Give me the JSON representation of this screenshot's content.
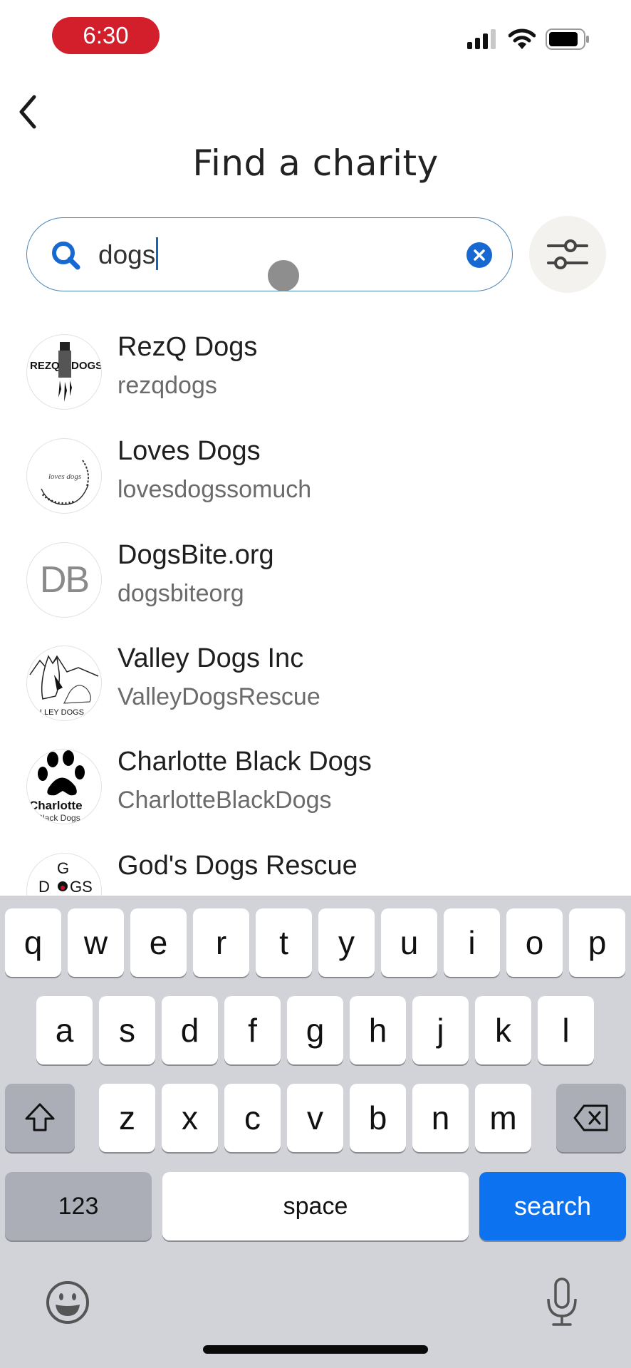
{
  "status_bar": {
    "time": "6:30",
    "time_pill_color": "#d21f2b",
    "icons": [
      "cellular-signal-icon",
      "wifi-icon",
      "battery-icon"
    ]
  },
  "header": {
    "back_icon": "chevron-left-icon",
    "title": "Find a charity"
  },
  "search": {
    "icon": "search-icon",
    "value": "dogs",
    "clear_icon": "clear-icon",
    "filter_icon": "sliders-icon",
    "accent_color": "#1769d1"
  },
  "results": [
    {
      "name": "RezQ Dogs",
      "handle": "rezqdogs",
      "avatar": "rezq-dogs-logo"
    },
    {
      "name": "Loves Dogs",
      "handle": "lovesdogssomuch",
      "avatar": "loves-dogs-logo"
    },
    {
      "name": "DogsBite.org",
      "handle": "dogsbiteorg",
      "avatar_initials": "DB"
    },
    {
      "name": "Valley Dogs Inc",
      "handle": "ValleyDogsRescue",
      "avatar": "valley-dogs-logo",
      "avatar_text": "VALLEY DOGS"
    },
    {
      "name": "Charlotte Black Dogs",
      "handle": "CharlotteBlackDogs",
      "avatar": "charlotte-paw-logo",
      "avatar_text": "Charlotte",
      "avatar_subtext": "Black Dogs"
    },
    {
      "name": "God's Dogs Rescue",
      "handle": "",
      "avatar": "gods-dogs-logo",
      "avatar_text": "DOGS"
    }
  ],
  "keyboard": {
    "row1": [
      "q",
      "w",
      "e",
      "r",
      "t",
      "y",
      "u",
      "i",
      "o",
      "p"
    ],
    "row2": [
      "a",
      "s",
      "d",
      "f",
      "g",
      "h",
      "j",
      "k",
      "l"
    ],
    "row3": [
      "z",
      "x",
      "c",
      "v",
      "b",
      "n",
      "m"
    ],
    "shift_icon": "shift-icon",
    "delete_icon": "backspace-icon",
    "numbers_label": "123",
    "space_label": "space",
    "search_label": "search",
    "search_key_color": "#0d72f0",
    "emoji_icon": "emoji-icon",
    "mic_icon": "microphone-icon"
  }
}
